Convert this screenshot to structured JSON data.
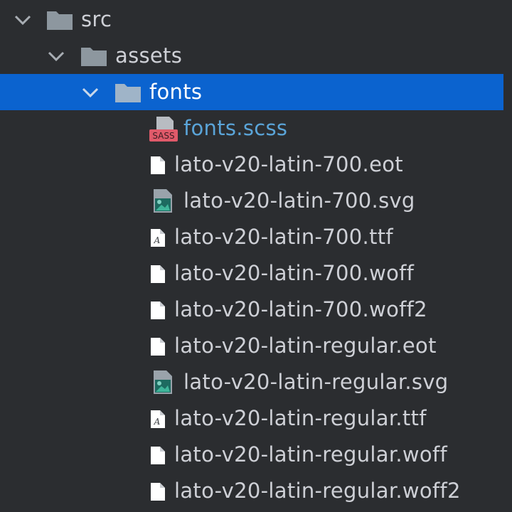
{
  "tree": {
    "src": {
      "label": "src",
      "icon": "folder-icon",
      "expanded": true
    },
    "assets": {
      "label": "assets",
      "icon": "folder-icon",
      "expanded": true
    },
    "fonts": {
      "label": "fonts",
      "icon": "folder-icon",
      "expanded": true,
      "selected": true
    },
    "files": [
      {
        "label": "fonts.scss",
        "icon": "sass-file-icon",
        "badge": "SASS"
      },
      {
        "label": "lato-v20-latin-700.eot",
        "icon": "file-icon"
      },
      {
        "label": "lato-v20-latin-700.svg",
        "icon": "image-file-icon"
      },
      {
        "label": "lato-v20-latin-700.ttf",
        "icon": "font-file-icon",
        "glyph": "A"
      },
      {
        "label": "lato-v20-latin-700.woff",
        "icon": "file-icon"
      },
      {
        "label": "lato-v20-latin-700.woff2",
        "icon": "file-icon"
      },
      {
        "label": "lato-v20-latin-regular.eot",
        "icon": "file-icon"
      },
      {
        "label": "lato-v20-latin-regular.svg",
        "icon": "image-file-icon"
      },
      {
        "label": "lato-v20-latin-regular.ttf",
        "icon": "font-file-icon",
        "glyph": "A"
      },
      {
        "label": "lato-v20-latin-regular.woff",
        "icon": "file-icon"
      },
      {
        "label": "lato-v20-latin-regular.woff2",
        "icon": "file-icon"
      }
    ]
  },
  "colors": {
    "background": "#2b2d30",
    "selection": "#0b63cf",
    "text": "#ced0d6",
    "sass_label": "#5aa4d8",
    "folder": "#8d979f"
  }
}
